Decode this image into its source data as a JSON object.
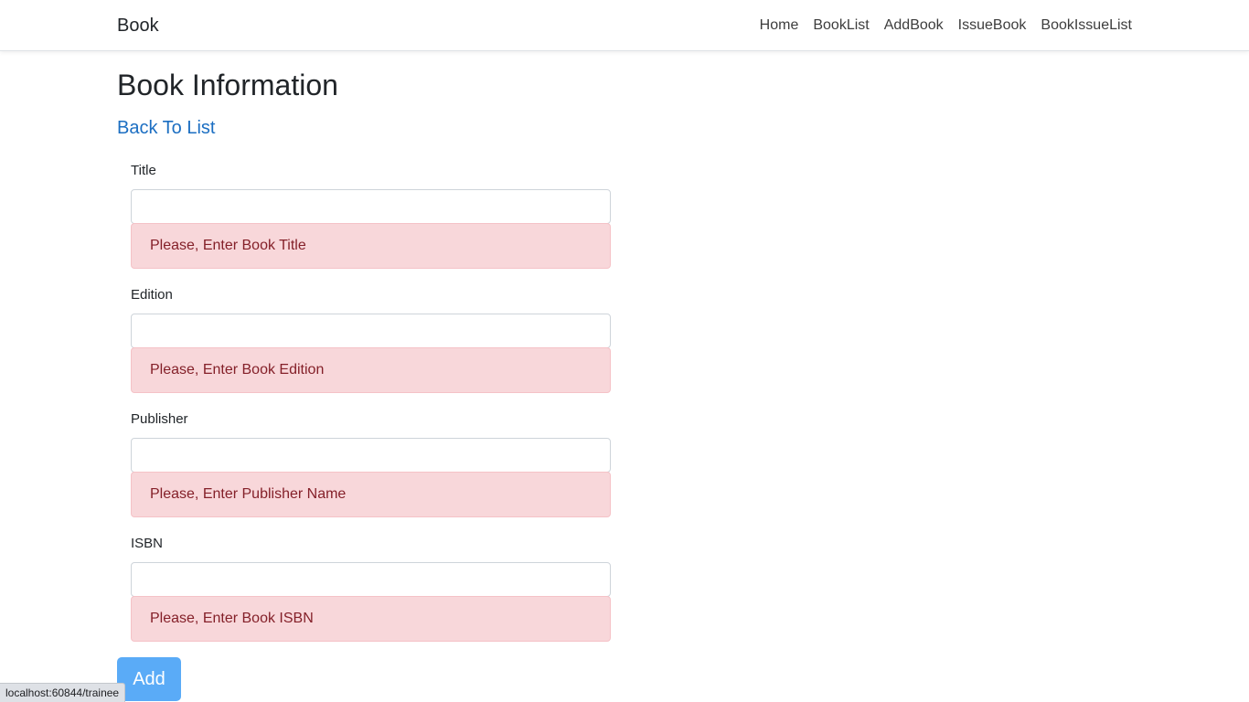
{
  "navbar": {
    "brand": "Book",
    "links": [
      {
        "label": "Home"
      },
      {
        "label": "BookList"
      },
      {
        "label": "AddBook"
      },
      {
        "label": "IssueBook"
      },
      {
        "label": "BookIssueList"
      }
    ]
  },
  "page": {
    "title": "Book Information",
    "back_link": "Back To List"
  },
  "form": {
    "fields": [
      {
        "label": "Title",
        "value": "",
        "error": "Please, Enter Book Title"
      },
      {
        "label": "Edition",
        "value": "",
        "error": "Please, Enter Book Edition"
      },
      {
        "label": "Publisher",
        "value": "",
        "error": "Please, Enter Publisher Name"
      },
      {
        "label": "ISBN",
        "value": "",
        "error": "Please, Enter Book ISBN"
      }
    ],
    "submit_label": "Add"
  },
  "status_bar": {
    "url": "localhost:60844/trainee"
  },
  "colors": {
    "link": "#1b6ec2",
    "alert_bg": "#f8d7da",
    "alert_text": "#842029",
    "button_bg": "#5aabf7"
  }
}
